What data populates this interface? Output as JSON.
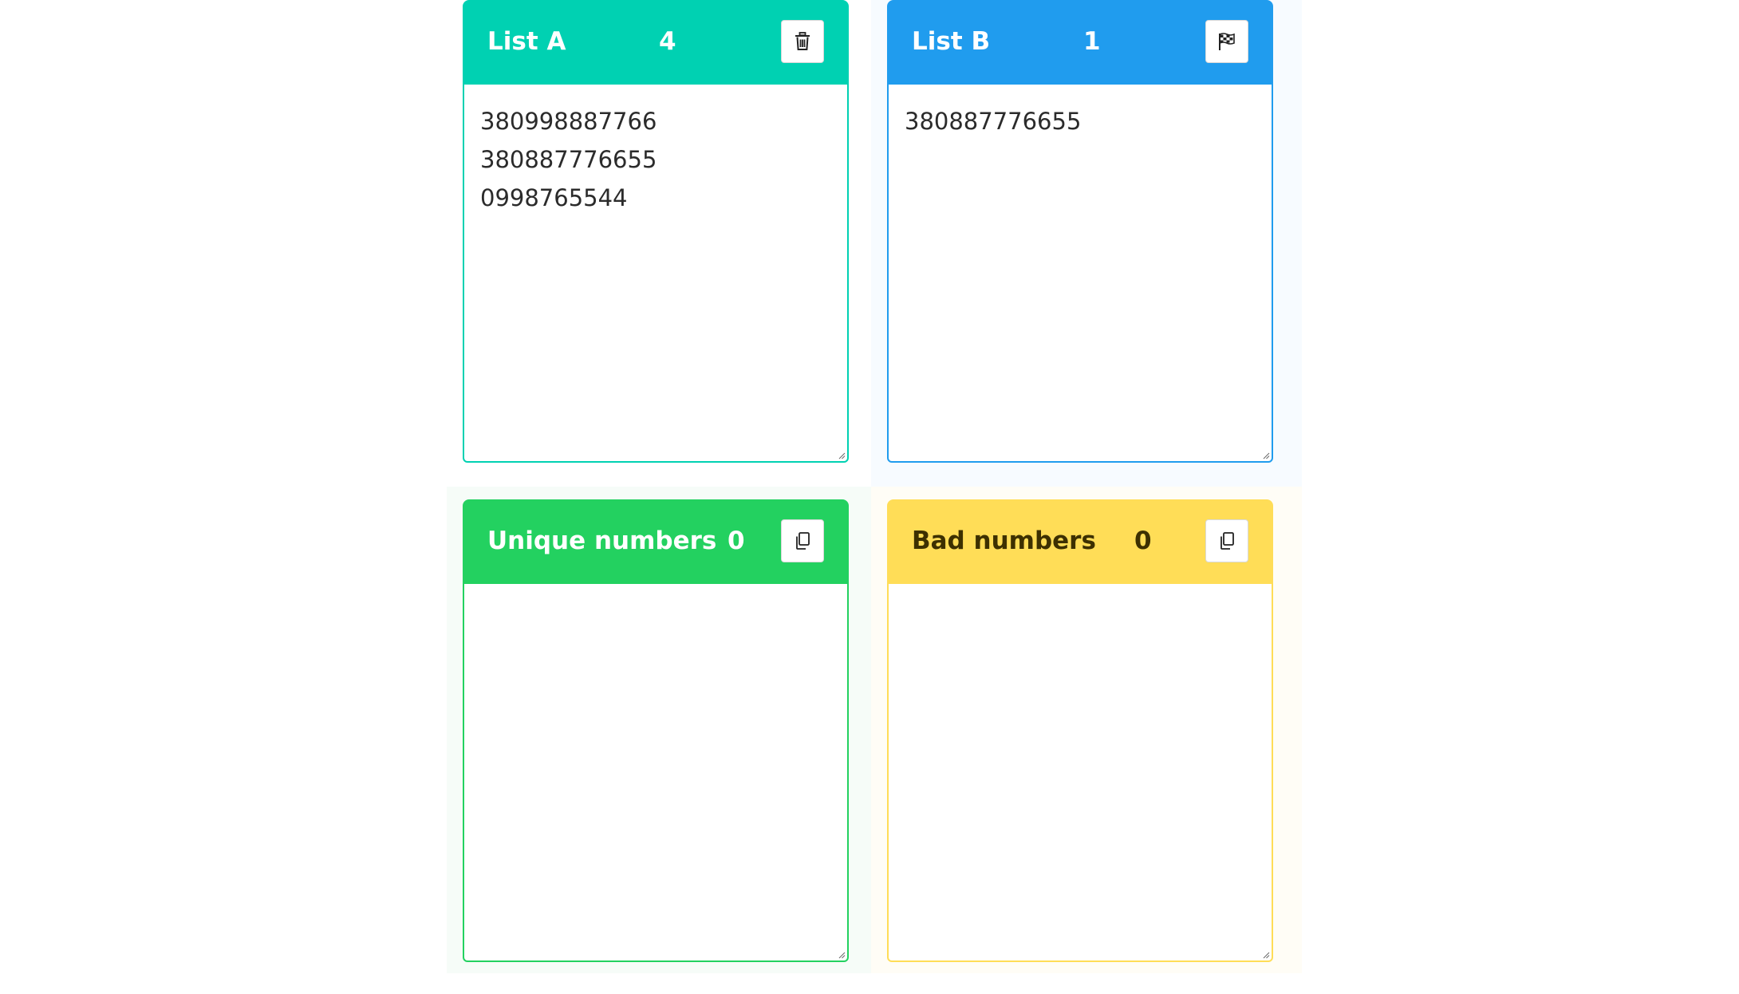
{
  "colors": {
    "list_a": "#00d1b2",
    "list_b": "#209cee",
    "unique": "#23d160",
    "bad": "#ffdd57"
  },
  "cards": {
    "list_a": {
      "title": "List A",
      "count": "4",
      "content": "380998887766\n380887776655\n0998765544",
      "action_icon": "trash-icon"
    },
    "list_b": {
      "title": "List B",
      "count": "1",
      "content": "380887776655",
      "action_icon": "checkered-flag-icon"
    },
    "unique": {
      "title": "Unique numbers",
      "count": "0",
      "content": "",
      "action_icon": "copy-icon"
    },
    "bad": {
      "title": "Bad numbers",
      "count": "0",
      "content": "",
      "action_icon": "copy-icon"
    }
  }
}
